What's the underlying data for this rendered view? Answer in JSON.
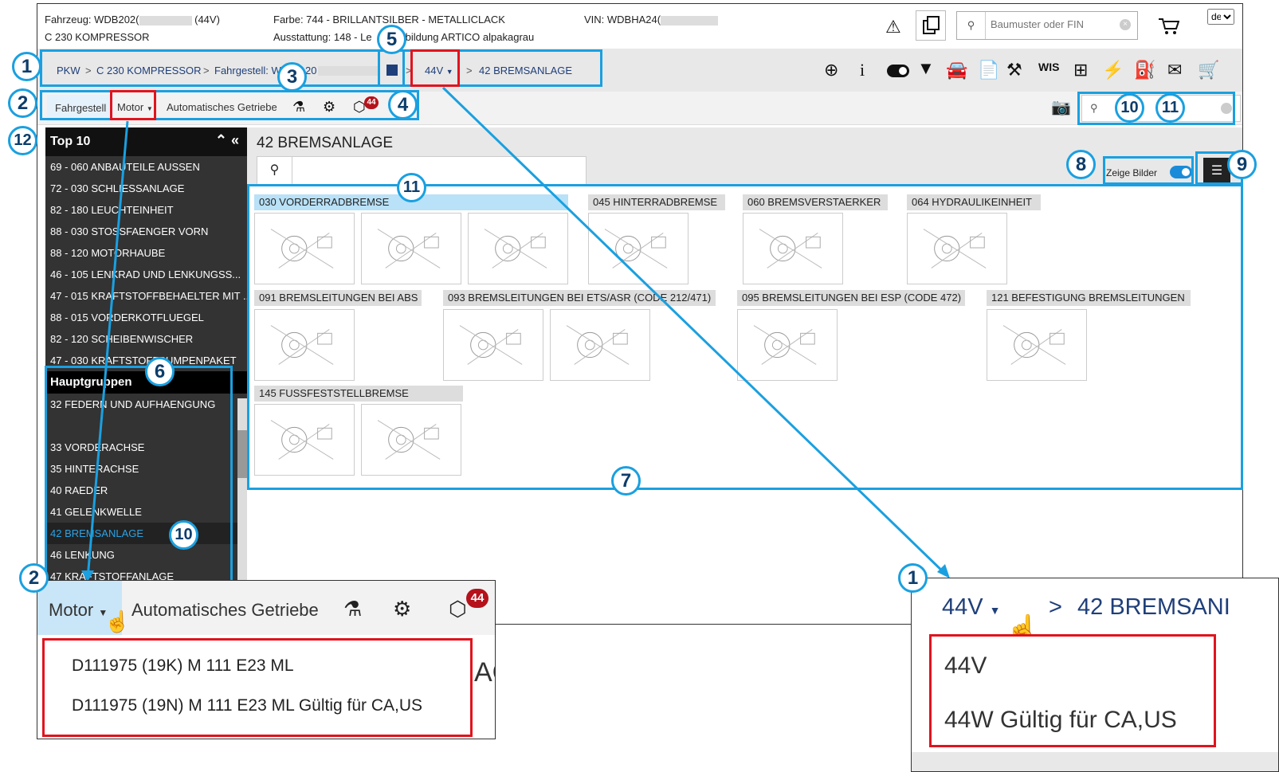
{
  "header": {
    "fahrzeug_label": "Fahrzeug: WDB202(",
    "fahrzeug_suffix": "(44V)",
    "model": "C 230 KOMPRESSOR",
    "farbe": "Farbe: 744 - BRILLANTSILBER - METALLICLACK",
    "ausstattung_a": "Ausstattung: 148 - Le",
    "ausstattung_b": "bildung ARTICO alpakagrau",
    "vin": "VIN: WDBHA24(",
    "search_placeholder": "Baumuster oder FIN",
    "lang": "de"
  },
  "breadcrumb": {
    "pkw": "PKW",
    "sep": ">",
    "model": "C 230 KOMPRESSOR",
    "fahrgestell": "Fahrgestell: W",
    "fg_num": "20",
    "engine_sel": "44V",
    "group": "42 BREMSANLAGE"
  },
  "nav": {
    "fahrgestell": "Fahrgestell",
    "motor": "Motor",
    "getriebe": "Automatisches Getriebe",
    "badge": "44"
  },
  "sidebar": {
    "top10_title": "Top 10",
    "top10": [
      "69 - 060 ANBAUTEILE AUSSEN",
      "72 - 030 SCHLIESSANLAGE",
      "82 - 180 LEUCHTEINHEIT",
      "88 - 030 STOSSFAENGER VORN",
      "88 - 120 MOTORHAUBE",
      "46 - 105 LENKRAD UND LENKUNGSS...",
      "47 - 015 KRAFTSTOFFBEHAELTER MIT ...",
      "88 - 015 VORDERKOTFLUEGEL",
      "82 - 120 SCHEIBENWISCHER",
      "47 - 030 KRAFTSTOFFPUMPENPAKET"
    ],
    "hg_title": "Hauptgruppen",
    "hg": [
      "32  FEDERN UND AUFHAENGUNG",
      "",
      "33  VORDERACHSE",
      "35  HINTERACHSE",
      "40  RAEDER",
      "41  GELENKWELLE",
      "42  BREMSANLAGE",
      "46  LENKUNG",
      "47  KRAFTSTOFFANLAGE"
    ]
  },
  "main": {
    "title": "42 BREMSANLAGE",
    "zeige_bilder": "Zeige Bilder",
    "tiles": [
      {
        "label": "030 VORDERRADBREMSE"
      },
      {
        "label": "045 HINTERRADBREMSE"
      },
      {
        "label": "060 BREMSVERSTAERKER"
      },
      {
        "label": "064 HYDRAULIKEINHEIT"
      },
      {
        "label": "091 BREMSLEITUNGEN BEI ABS"
      },
      {
        "label": "093 BREMSLEITUNGEN BEI ETS/ASR (CODE 212/471)"
      },
      {
        "label": "095 BREMSLEITUNGEN BEI ESP (CODE 472)"
      },
      {
        "label": "121 BEFESTIGUNG BREMSLEITUNGEN"
      },
      {
        "label": "145 FUSSFESTSTELLBREMSE"
      }
    ]
  },
  "zoom_motor": {
    "motor": "Motor",
    "getriebe": "Automatisches Getriebe",
    "badge": "44",
    "opt1": "D111975 (19K) M 111 E23 ML",
    "opt2": "D111975 (19N) M 111 E23 ML Gültig für CA,US",
    "behind": "AG"
  },
  "zoom_engine": {
    "sel": "44V",
    "sep": ">",
    "group": "42 BREMSANI",
    "opt1": "44V",
    "opt2": "44W Gültig für CA,US"
  },
  "callouts": {
    "c1": "1",
    "c2": "2",
    "c3": "3",
    "c4": "4",
    "c5": "5",
    "c6": "6",
    "c7": "7",
    "c8": "8",
    "c9": "9",
    "c10": "10",
    "c11": "11",
    "c12": "12"
  },
  "colors": {
    "accent": "#1aa0e0",
    "red": "#e0141e",
    "dark": "#333333"
  }
}
